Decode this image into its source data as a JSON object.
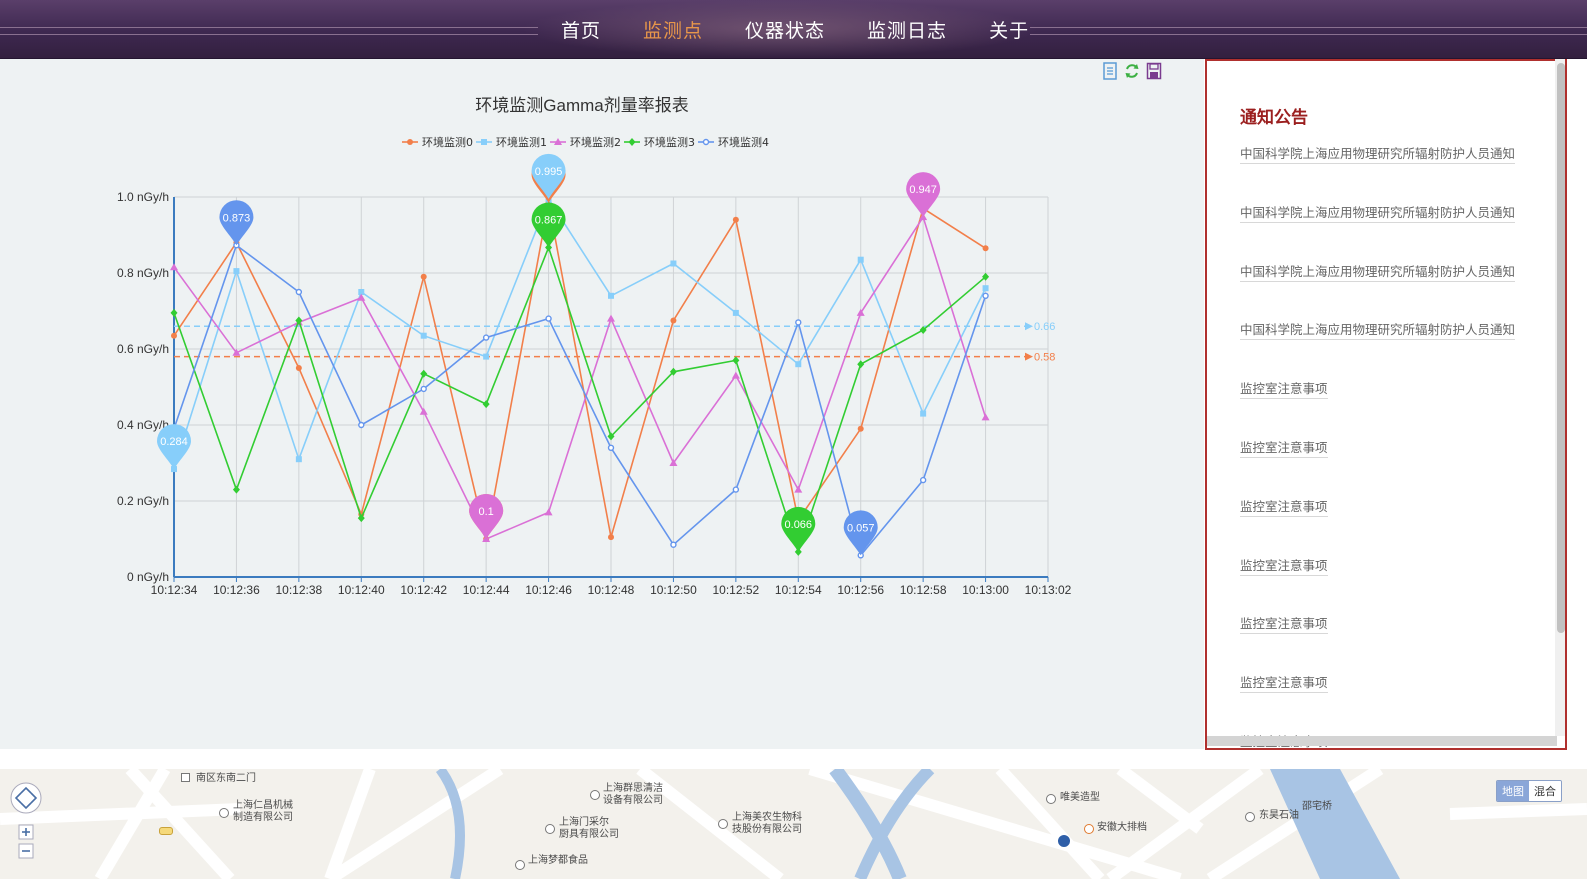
{
  "nav": {
    "items": [
      {
        "label": "首页",
        "active": false
      },
      {
        "label": "监测点",
        "active": true
      },
      {
        "label": "仪器状态",
        "active": false
      },
      {
        "label": "监测日志",
        "active": false
      },
      {
        "label": "关于",
        "active": false
      }
    ],
    "active_color": "#e8964a"
  },
  "toolbar": {
    "icons": [
      "data-view-icon",
      "refresh-icon",
      "save-image-icon"
    ]
  },
  "chart_data": {
    "type": "line",
    "title": "环境监测Gamma剂量率报表",
    "x": [
      "10:12:34",
      "10:12:36",
      "10:12:38",
      "10:12:40",
      "10:12:42",
      "10:12:44",
      "10:12:46",
      "10:12:48",
      "10:12:50",
      "10:12:52",
      "10:12:54",
      "10:12:56",
      "10:12:58",
      "10:13:00"
    ],
    "x_ticks": [
      "10:12:34",
      "10:12:36",
      "10:12:38",
      "10:12:40",
      "10:12:42",
      "10:12:44",
      "10:12:46",
      "10:12:48",
      "10:12:50",
      "10:12:52",
      "10:12:54",
      "10:12:56",
      "10:12:58",
      "10:13:00",
      "10:13:02"
    ],
    "y_ticks": [
      "0 nGy/h",
      "0.2 nGy/h",
      "0.4 nGy/h",
      "0.6 nGy/h",
      "0.8 nGy/h",
      "1.0 nGy/h"
    ],
    "ylim": [
      0,
      1.0
    ],
    "grid": true,
    "legend_position": "top-center",
    "series": [
      {
        "name": "环境监测0",
        "color": "#f27f4a",
        "marker": "circle",
        "values": [
          0.635,
          0.88,
          0.55,
          0.165,
          0.79,
          0.1,
          0.985,
          0.105,
          0.675,
          0.94,
          0.15,
          0.39,
          0.97,
          0.865
        ],
        "max": {
          "index": 6,
          "value": ""
        },
        "min": {
          "index": 5,
          "value": ""
        },
        "mark_line": {
          "label": "0.58",
          "value": 0.58
        }
      },
      {
        "name": "环境监测1",
        "color": "#87cefa",
        "marker": "rect",
        "values": [
          0.284,
          0.805,
          0.31,
          0.75,
          0.635,
          0.58,
          0.995,
          0.74,
          0.825,
          0.695,
          0.56,
          0.835,
          0.43,
          0.76
        ],
        "max": {
          "index": 6,
          "value": "0.995"
        },
        "min": {
          "index": 0,
          "value": "0.284"
        },
        "mark_line": {
          "label": "0.66",
          "value": 0.66
        }
      },
      {
        "name": "环境监测2",
        "color": "#da70d6",
        "marker": "triangle",
        "values": [
          0.815,
          0.59,
          0.67,
          0.735,
          0.435,
          0.1,
          0.17,
          0.68,
          0.3,
          0.53,
          0.23,
          0.695,
          0.947,
          0.42
        ],
        "max": {
          "index": 12,
          "value": "0.947"
        },
        "min": {
          "index": 5,
          "value": "0.1"
        }
      },
      {
        "name": "环境监测3",
        "color": "#32cd32",
        "marker": "diamond",
        "values": [
          0.695,
          0.23,
          0.675,
          0.155,
          0.535,
          0.455,
          0.867,
          0.37,
          0.54,
          0.57,
          0.066,
          0.56,
          0.65,
          0.79
        ],
        "max": {
          "index": 6,
          "value": "0.867"
        },
        "min": {
          "index": 10,
          "value": "0.066"
        }
      },
      {
        "name": "环境监测4",
        "color": "#6495ed",
        "marker": "emptyCircle",
        "values": [
          0.39,
          0.873,
          0.75,
          0.4,
          0.495,
          0.63,
          0.68,
          0.34,
          0.085,
          0.23,
          0.67,
          0.057,
          0.255,
          0.74
        ],
        "max": {
          "index": 1,
          "value": "0.873"
        },
        "min": {
          "index": 11,
          "value": "0.057"
        }
      }
    ]
  },
  "notices": {
    "title": "通知公告",
    "items": [
      "中国科学院上海应用物理研究所辐射防护人员通知",
      "中国科学院上海应用物理研究所辐射防护人员通知",
      "中国科学院上海应用物理研究所辐射防护人员通知",
      "中国科学院上海应用物理研究所辐射防护人员通知",
      "监控室注意事项",
      "监控室注意事项",
      "监控室注意事项",
      "监控室注意事项",
      "监控室注意事项",
      "监控室注意事项",
      "监控室注意事项"
    ]
  },
  "map": {
    "labels": [
      {
        "text": "南区东南二门"
      },
      {
        "text": "上海仁昌机械\n制造有限公司"
      },
      {
        "text": "上海群思清洁\n设备有限公司"
      },
      {
        "text": "上海门采尔\n厨具有限公司"
      },
      {
        "text": "上海美农生物科\n技股份有限公司"
      },
      {
        "text": "上海梦都食品"
      },
      {
        "text": "唯美造型"
      },
      {
        "text": "安徽大排档"
      },
      {
        "text": "东昊石油"
      },
      {
        "text": "邵宅桥"
      }
    ],
    "type_buttons": {
      "map": "地图",
      "hybrid": "混合"
    }
  }
}
